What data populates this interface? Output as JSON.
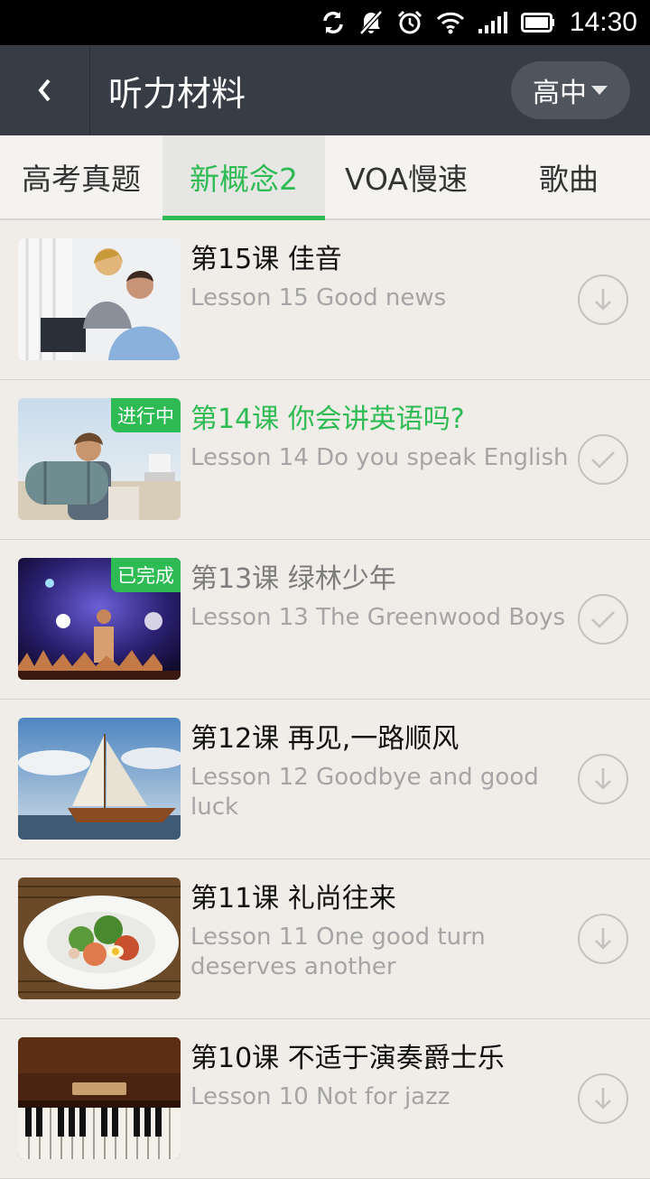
{
  "status_bar": {
    "time": "14:30"
  },
  "header": {
    "title": "听力材料",
    "grade_label": "高中"
  },
  "tabs": [
    {
      "label": "高考真题"
    },
    {
      "label": "新概念2"
    },
    {
      "label": "VOA慢速"
    },
    {
      "label": "歌曲"
    }
  ],
  "lessons": [
    {
      "title": "第15课 佳音",
      "subtitle": "Lesson 15  Good news",
      "badge": "",
      "action_icon": "download-icon"
    },
    {
      "title": "第14课 你会讲英语吗?",
      "subtitle": "Lesson 14  Do you speak English",
      "badge": "进行中",
      "action_icon": "check-icon"
    },
    {
      "title": "第13课 绿林少年",
      "subtitle": "Lesson 13  The Greenwood Boys",
      "badge": "已完成",
      "action_icon": "check-icon"
    },
    {
      "title": "第12课 再见,一路顺风",
      "subtitle": "Lesson 12  Goodbye and good luck",
      "badge": "",
      "action_icon": "download-icon"
    },
    {
      "title": "第11课 礼尚往来",
      "subtitle": "Lesson 11  One good turn deserves another",
      "badge": "",
      "action_icon": "download-icon"
    },
    {
      "title": "第10课 不适于演奏爵士乐",
      "subtitle": "Lesson 10  Not for jazz",
      "badge": "",
      "action_icon": "download-icon"
    }
  ],
  "colors": {
    "accent": "#2fbb53",
    "title_bar": "#383c44"
  }
}
